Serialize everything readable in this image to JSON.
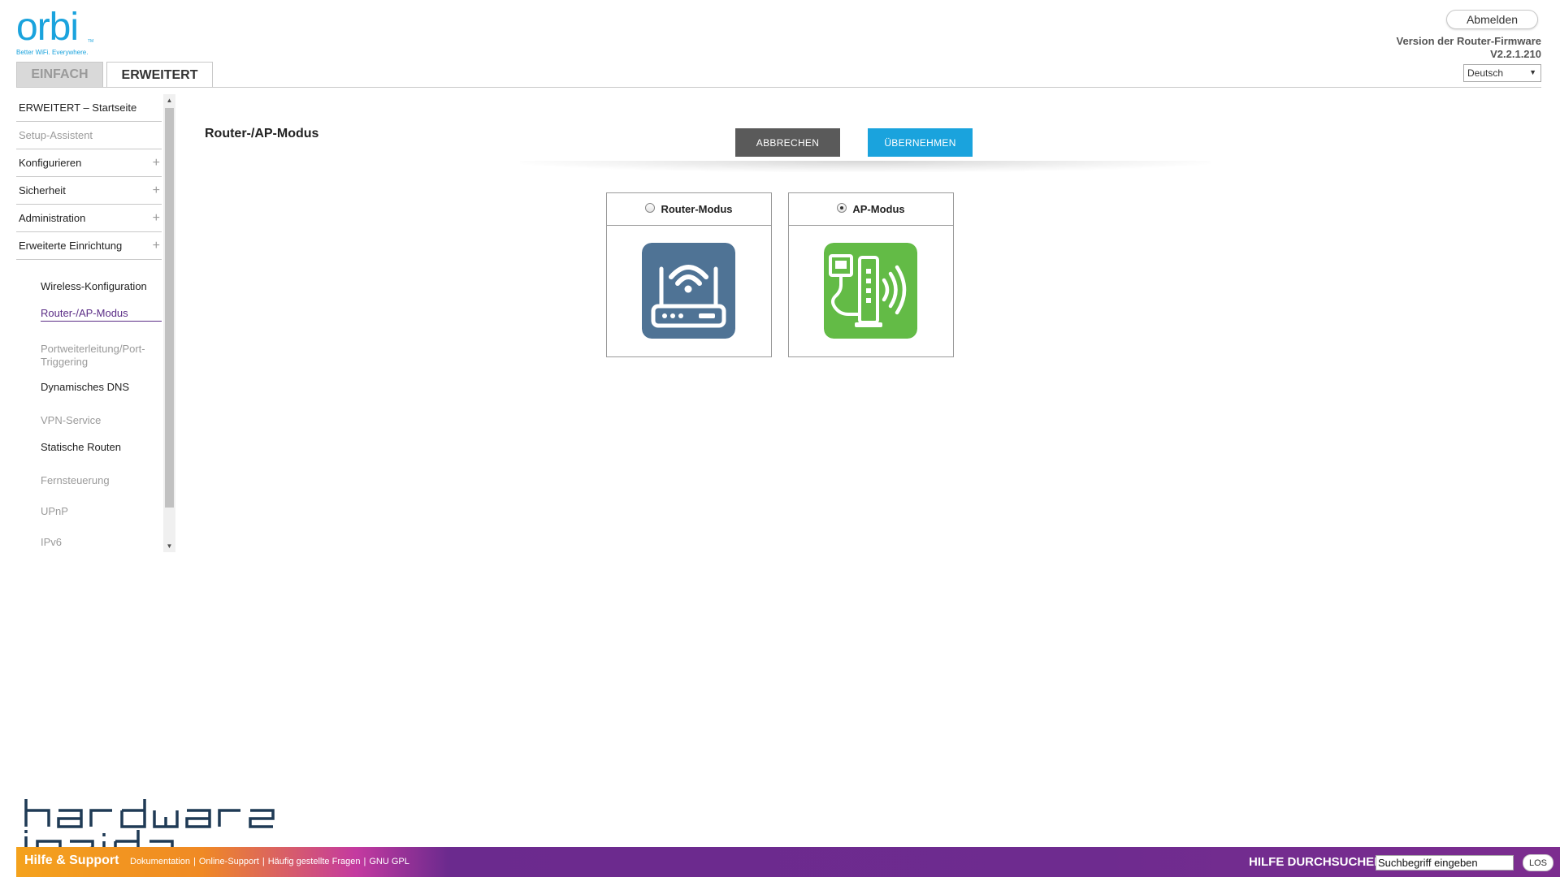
{
  "header": {
    "logo_text": "orbi",
    "logo_tm": "TM",
    "logo_tagline": "Better WiFi. Everywhere.",
    "logout_label": "Abmelden",
    "firmware_label": "Version der Router-Firmware",
    "firmware_version": "V2.2.1.210",
    "language_selected": "Deutsch"
  },
  "tabs": [
    {
      "label": "EINFACH",
      "active": false
    },
    {
      "label": "ERWEITERT",
      "active": true
    }
  ],
  "sidebar": {
    "items": [
      {
        "label": "ERWEITERT – Startseite"
      },
      {
        "label": "Setup-Assistent"
      },
      {
        "label": "Konfigurieren",
        "expand": "+"
      },
      {
        "label": "Sicherheit",
        "expand": "+"
      },
      {
        "label": "Administration",
        "expand": "+"
      },
      {
        "label": "Erweiterte Einrichtung",
        "expand": "+"
      }
    ],
    "subitems": [
      {
        "label": "Wireless-Konfiguration"
      },
      {
        "label": "Router-/AP-Modus"
      },
      {
        "label": "Portweiterleitung/Port-Triggering"
      },
      {
        "label": "Dynamisches DNS"
      },
      {
        "label": "VPN-Service"
      },
      {
        "label": "Statische Routen"
      },
      {
        "label": "Fernsteuerung"
      },
      {
        "label": "UPnP"
      },
      {
        "label": "IPv6"
      }
    ]
  },
  "main": {
    "title": "Router-/AP-Modus",
    "cancel_label": "ABBRECHEN",
    "apply_label": "ÜBERNEHMEN",
    "modes": [
      {
        "label": "Router-Modus",
        "selected": false,
        "icon": "router-icon",
        "color": "#4f7395"
      },
      {
        "label": "AP-Modus",
        "selected": true,
        "icon": "access-point-icon",
        "color": "#63bb46"
      }
    ]
  },
  "footer": {
    "brand": "Hilfe & Support",
    "links": [
      "Dokumentation",
      "Online-Support",
      "Häufig gestellte Fragen",
      "GNU GPL"
    ],
    "search_label": "HILFE DURCHSUCHEN",
    "search_value": "Suchbegriff eingeben",
    "go_label": "LOS"
  },
  "watermark": "hardware inside"
}
